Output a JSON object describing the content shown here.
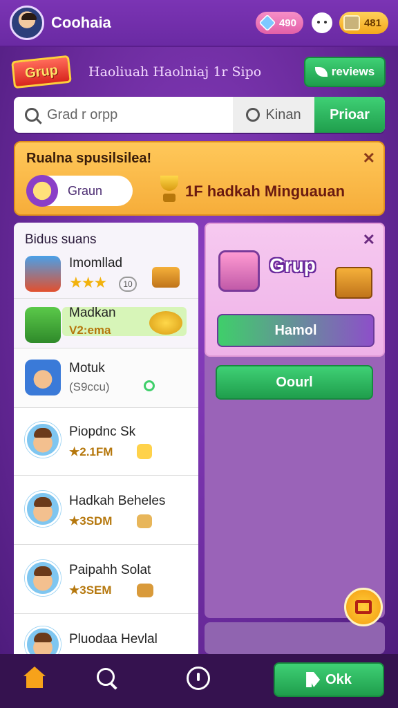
{
  "header": {
    "app_title": "Coohaia",
    "gems": "490",
    "coins": "481",
    "colors": {
      "header_bg": "#7b34b4",
      "gems_pill": "#e260a8",
      "coins_pill": "#f4a81c"
    }
  },
  "group_row": {
    "badge": "Grup",
    "subtitle": "Haoliuah Haolniaj 1r Sipo",
    "reviews_label": "reviews"
  },
  "search": {
    "placeholder": "Grad r orpp",
    "filter_label": "Kinan",
    "button_label": "Prioar"
  },
  "banner": {
    "title": "Rualna spusilsilea!",
    "chip_label": "Graun",
    "text": "1F hadkah Minguauan"
  },
  "list": {
    "heading": "Bidus suans",
    "items": [
      {
        "name": "Imomllad",
        "stars": "★★★",
        "badge": "10",
        "icon": "toy-truck-icon"
      },
      {
        "name": "Madkan",
        "sub": "V2:ema",
        "icon": "gift-box-icon"
      },
      {
        "name": "Motuk",
        "sub": "(S9ccu)",
        "icon": "avatar-icon"
      },
      {
        "name": "Piopdnc Sk",
        "sub": "★2.1FM",
        "icon": "avatar-icon"
      },
      {
        "name": "Hadkah Beheles",
        "sub": "★3SDM",
        "icon": "avatar-icon"
      },
      {
        "name": "Paipahh Solat",
        "sub": "★3SEM",
        "icon": "avatar-icon"
      },
      {
        "name": "Pluodaa Hevlal",
        "icon": "avatar-icon"
      }
    ]
  },
  "group_card": {
    "title": "Grup",
    "action_label": "Hamol",
    "open_label": "Oourl"
  },
  "bottom_nav": {
    "ok_label": "Okk"
  }
}
